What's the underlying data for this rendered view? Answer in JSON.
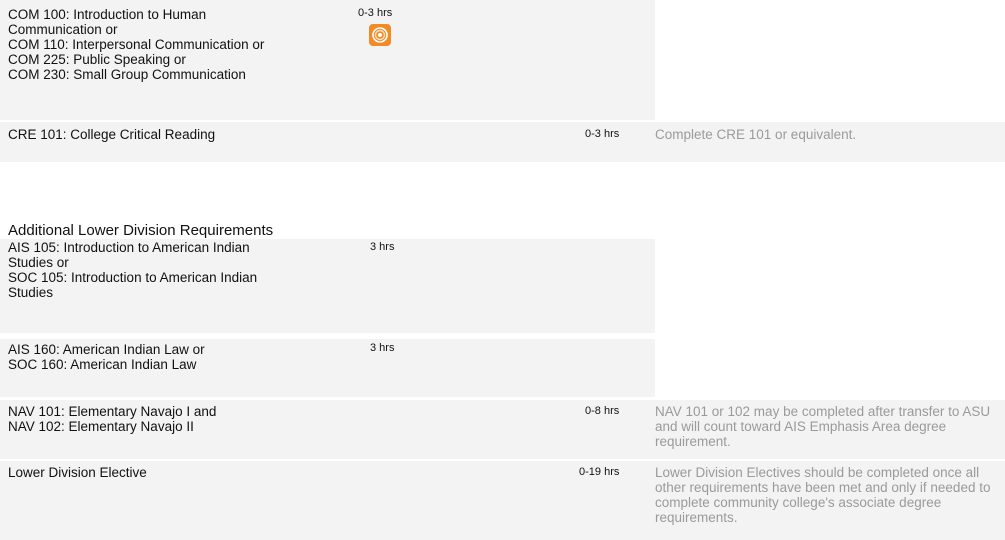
{
  "colors": {
    "row_bg": "#f3f3f3",
    "note_text": "#9a9a9a",
    "icon_orange": "#f28b25"
  },
  "section1": {
    "rows": [
      {
        "lines": [
          "COM 100: Introduction to Human",
          "Communication or",
          "COM 110: Interpersonal Communication or",
          "COM 225: Public Speaking or",
          "COM 230: Small Group Communication"
        ],
        "hours": "0-3 hrs",
        "icon": "target-badge-icon"
      },
      {
        "lines": [
          "CRE 101: College Critical Reading"
        ],
        "hours": "0-3 hrs",
        "note": "Complete CRE 101 or equivalent."
      }
    ]
  },
  "section2": {
    "heading": "Additional Lower Division Requirements",
    "rows": [
      {
        "lines": [
          "AIS 105: Introduction to American Indian",
          "Studies or",
          "SOC 105: Introduction to American Indian",
          "Studies"
        ],
        "hours": "3 hrs"
      },
      {
        "lines": [
          "AIS 160: American Indian Law or",
          "SOC 160: American Indian Law"
        ],
        "hours": "3 hrs"
      },
      {
        "lines": [
          "NAV 101: Elementary Navajo I and",
          "NAV 102: Elementary Navajo II"
        ],
        "hours": "0-8 hrs",
        "note": "NAV 101 or 102 may be completed after transfer to ASU and will count toward AIS Emphasis Area degree requirement."
      },
      {
        "lines": [
          "Lower Division Elective"
        ],
        "hours": "0-19 hrs",
        "note": "Lower Division Electives should be completed once all other requirements have been met and only if needed to complete community college's associate degree requirements."
      }
    ]
  }
}
